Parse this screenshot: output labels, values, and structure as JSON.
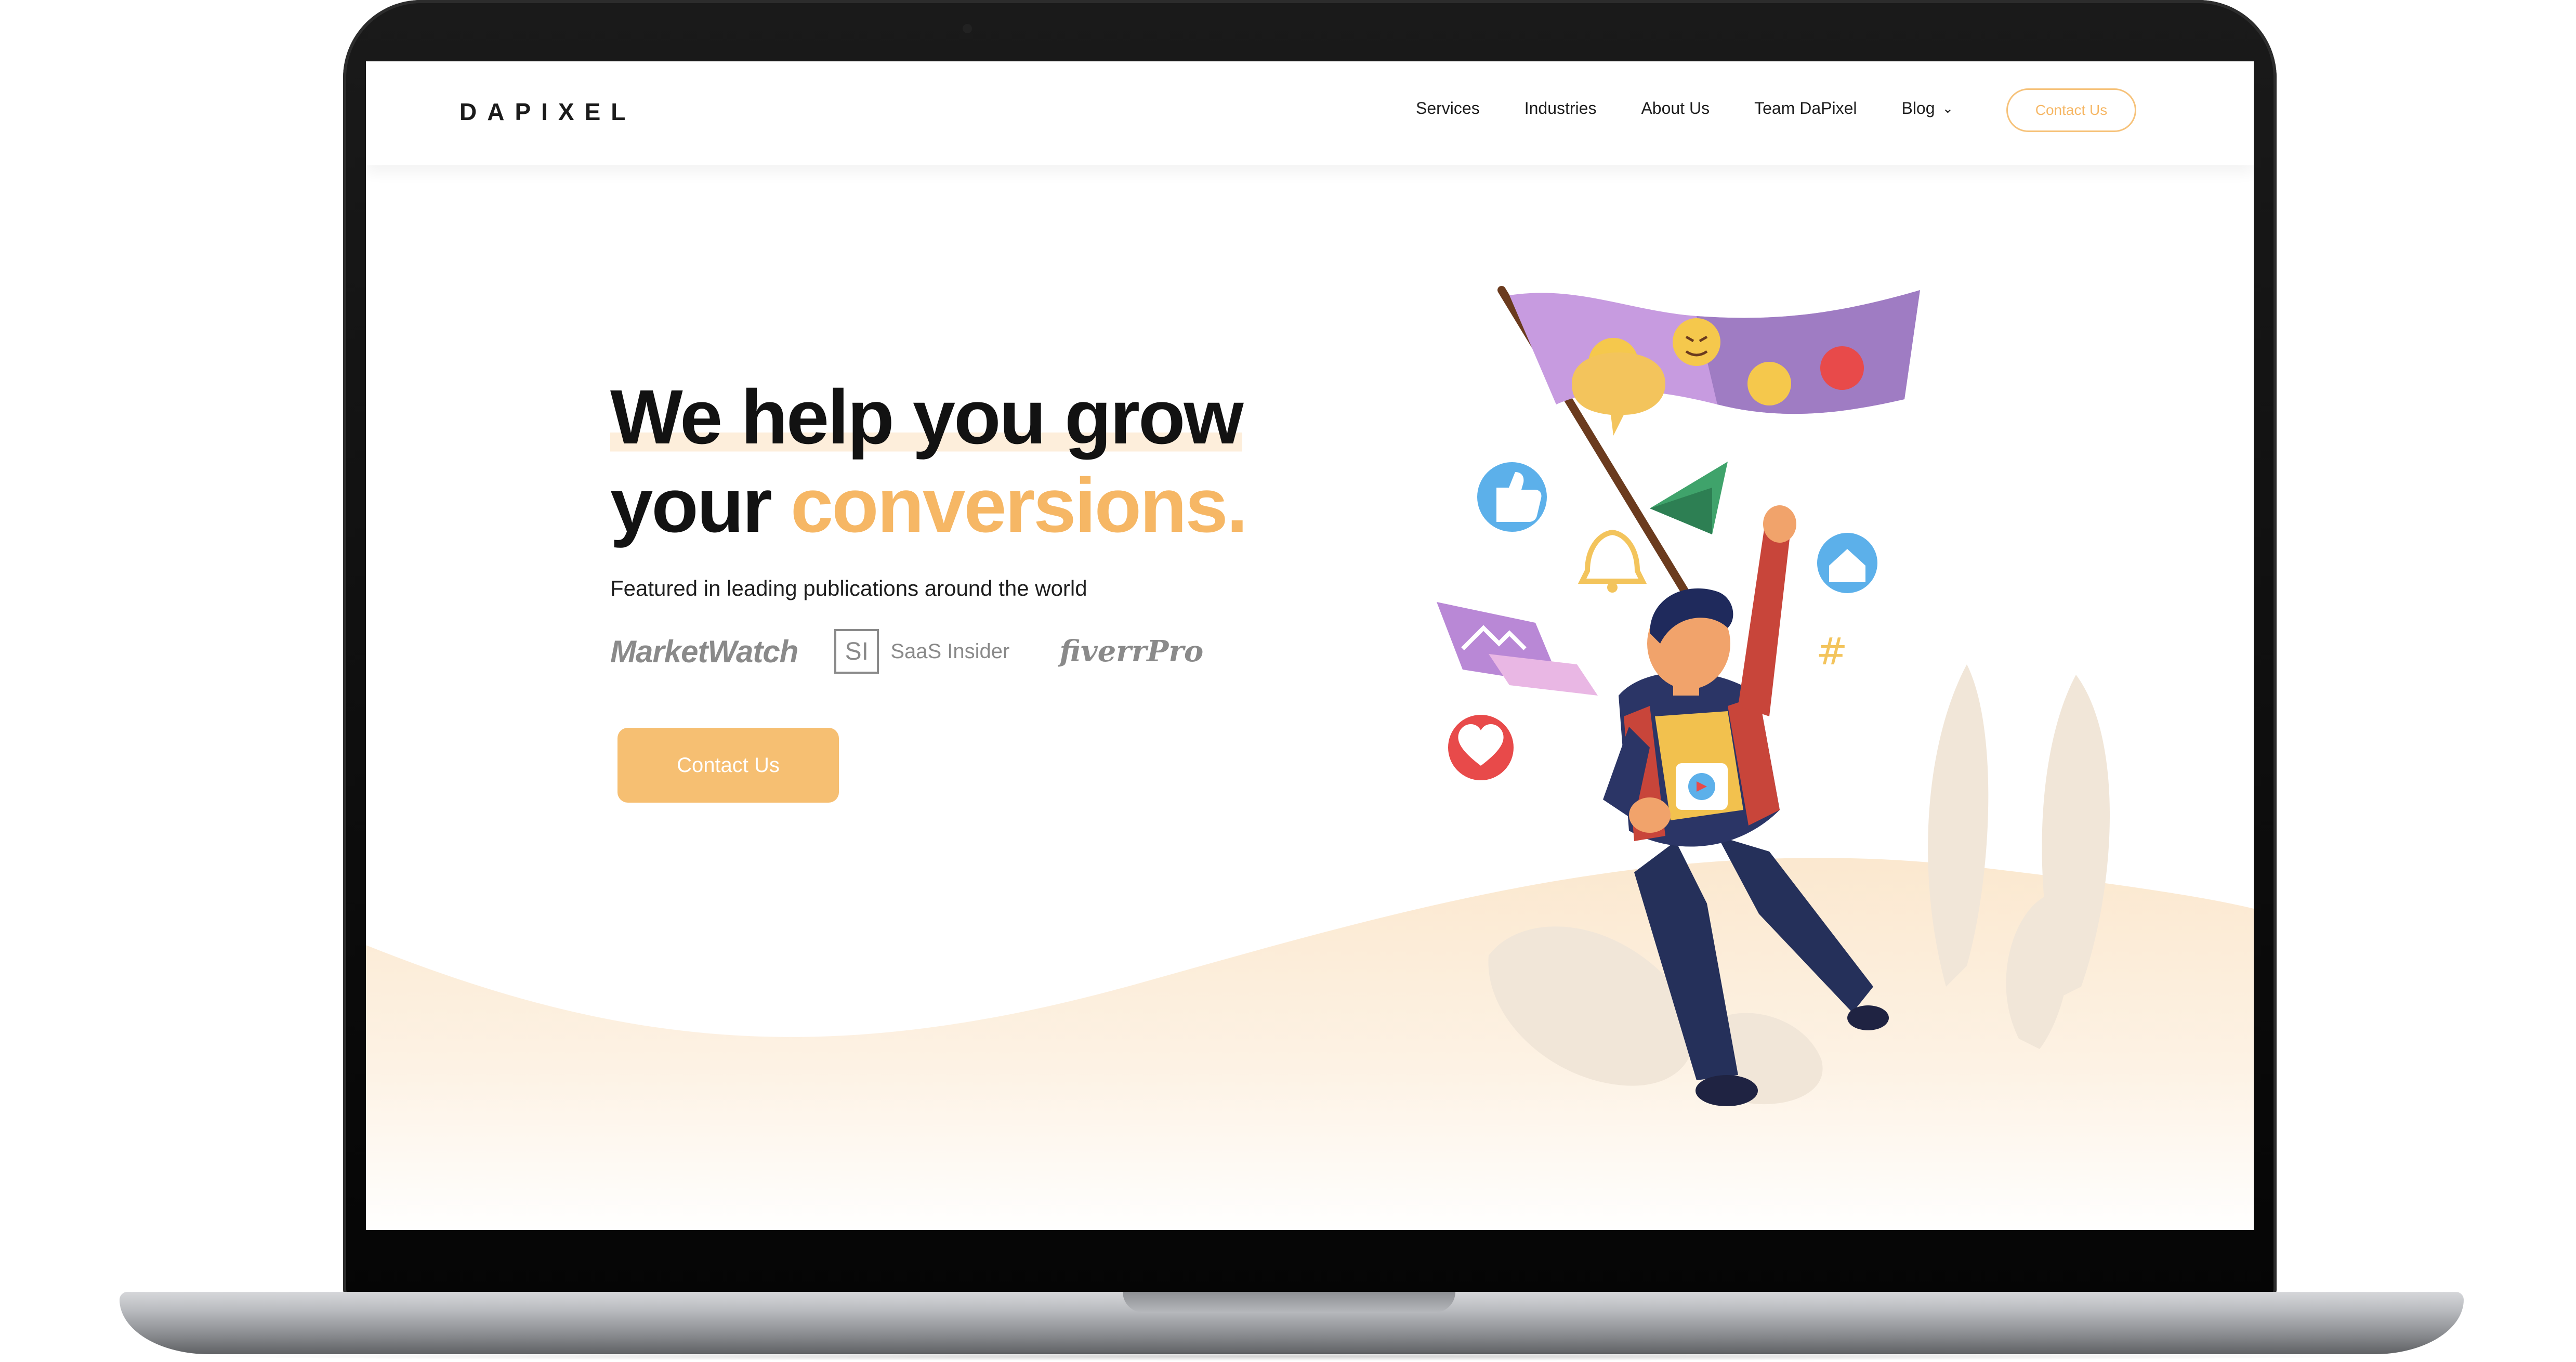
{
  "brand": {
    "logo": "DAPIXEL",
    "accent": "#f6b765",
    "text": "#121212"
  },
  "nav": {
    "items": [
      "Services",
      "Industries",
      "About Us",
      "Team DaPixel"
    ],
    "blog": "Blog",
    "cta": "Contact Us"
  },
  "hero": {
    "title_line1": "We help you grow",
    "title_line2_prefix": "your ",
    "title_line2_accent": "conversions.",
    "featured": "Featured in leading publications around the world",
    "publications": {
      "marketwatch": "MarketWatch",
      "si_mark": "SI",
      "saas": "SaaS Insider",
      "fiverr": "fiverrPro"
    },
    "cta": "Contact Us"
  },
  "illustration": {
    "icons": [
      "flag-icon",
      "speech-bubble-icon",
      "thumbs-up-icon",
      "paper-plane-icon",
      "bell-icon",
      "home-icon",
      "hashtag-icon",
      "heart-icon",
      "image-icon"
    ]
  }
}
